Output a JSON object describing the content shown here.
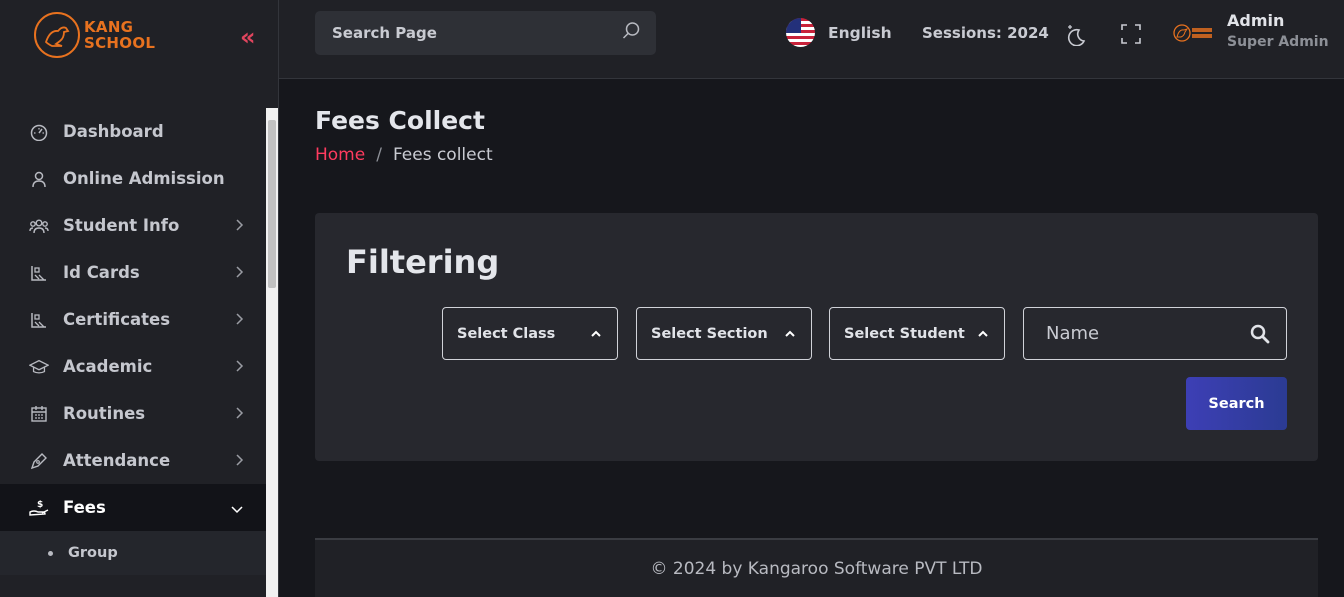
{
  "brand": {
    "line1": "KANG",
    "line2": "SCHOOL"
  },
  "sidebar": {
    "items": [
      {
        "label": "Dashboard",
        "icon": "gauge-icon"
      },
      {
        "label": "Online Admission",
        "icon": "user-icon"
      },
      {
        "label": "Student Info",
        "icon": "users-icon"
      },
      {
        "label": "Id Cards",
        "icon": "id-card-icon"
      },
      {
        "label": "Certificates",
        "icon": "certificate-icon"
      },
      {
        "label": "Academic",
        "icon": "graduation-cap-icon"
      },
      {
        "label": "Routines",
        "icon": "calendar-icon"
      },
      {
        "label": "Attendance",
        "icon": "pen-icon"
      },
      {
        "label": "Fees",
        "icon": "money-hand-icon"
      }
    ],
    "sub_items": [
      {
        "label": "Group"
      }
    ]
  },
  "header": {
    "search_placeholder": "Search Page",
    "language": "English",
    "session": "Sessions: 2024",
    "user_name": "Admin",
    "user_role": "Super Admin"
  },
  "page": {
    "title": "Fees Collect",
    "breadcrumb_home": "Home",
    "breadcrumb_sep": "/",
    "breadcrumb_current": "Fees collect"
  },
  "filter": {
    "title": "Filtering",
    "select_class": "Select Class",
    "select_section": "Select Section",
    "select_student": "Select Student",
    "name_placeholder": "Name",
    "search_button": "Search"
  },
  "footer": {
    "text": "© 2024 by Kangaroo Software PVT LTD"
  },
  "colors": {
    "accent": "#ff3b5f",
    "brand": "#e8721f",
    "button": "#3d3fb5"
  }
}
